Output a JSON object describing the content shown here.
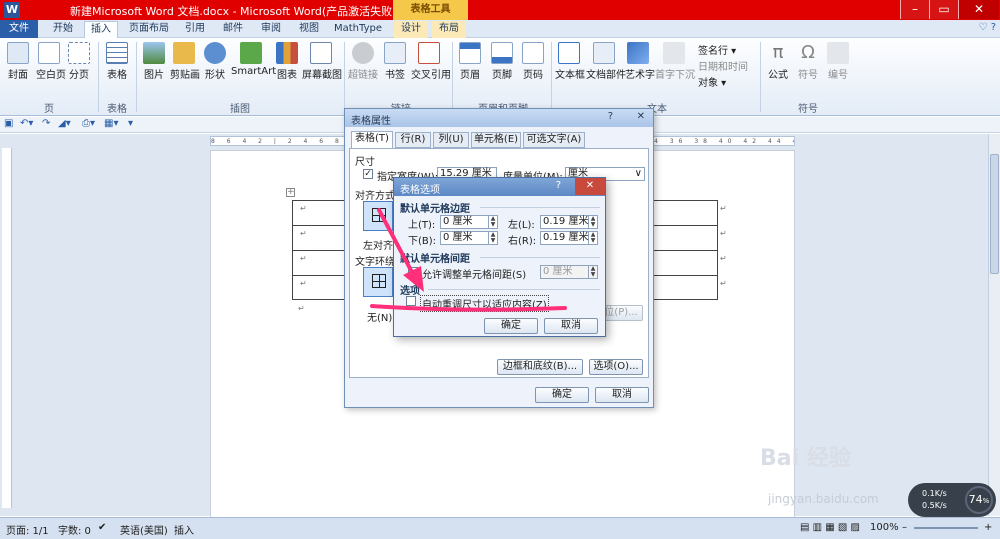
{
  "window": {
    "title": "新建Microsoft Word 文档.docx - Microsoft Word(产品激活失败)",
    "contextual_group": "表格工具",
    "quick_access_icon": "W",
    "controls": {
      "minimize": "–",
      "restore": "▭",
      "close": "✕"
    }
  },
  "ribbon_tabs": [
    "文件",
    "开始",
    "插入",
    "页面布局",
    "引用",
    "邮件",
    "审阅",
    "视图",
    "MathType",
    "设计",
    "布局"
  ],
  "ribbon_help": "♡ ?",
  "ribbon": {
    "page_group": {
      "name": "页",
      "buttons": [
        "封面",
        "空白页",
        "分页"
      ]
    },
    "table_group": {
      "name": "表格",
      "buttons": [
        "表格"
      ]
    },
    "illustrations_group": {
      "name": "插图",
      "buttons": [
        "图片",
        "剪贴画",
        "形状",
        "SmartArt",
        "图表",
        "屏幕截图"
      ]
    },
    "links_group": {
      "name": "链接",
      "buttons": [
        "超链接",
        "书签",
        "交叉引用"
      ]
    },
    "header_footer_group": {
      "name": "页眉和页脚",
      "buttons": [
        "页眉",
        "页脚",
        "页码"
      ]
    },
    "text_group": {
      "name": "文本",
      "buttons": [
        "文本框",
        "文档部件",
        "艺术字",
        "首字下沉"
      ],
      "small": [
        "签名行 ▾",
        "日期和时间",
        "对象 ▾"
      ]
    },
    "symbols_group": {
      "name": "符号",
      "buttons": [
        "公式",
        "符号",
        "编号"
      ]
    }
  },
  "status_bar": {
    "page": "页面: 1/1",
    "words": "字数: 0",
    "language": "英语(美国)",
    "mode": "插入",
    "zoom": "100%",
    "zoom_minus": "–",
    "zoom_plus": "+"
  },
  "table_properties_dialog": {
    "title": "表格属性",
    "help": "?",
    "close": "✕",
    "tabs": [
      "表格(T)",
      "行(R)",
      "列(U)",
      "单元格(E)",
      "可选文字(A)"
    ],
    "size_label": "尺寸",
    "preferred_width_label": "指定宽度(W):",
    "preferred_width_value": "15.29 厘米",
    "measure_in_label": "度量单位(M):",
    "measure_in_value": "厘米",
    "alignment_label": "对齐方式",
    "alignment_left": "左对齐",
    "wrapping_label": "文字环绕",
    "wrapping_none": "无(N)",
    "positioning_button": "定位(P)...",
    "borders_button": "边框和底纹(B)...",
    "options_button": "选项(O)...",
    "ok": "确定",
    "cancel": "取消"
  },
  "table_options_dialog": {
    "title": "表格选项",
    "help": "?",
    "close": "✕",
    "default_margins_heading": "默认单元格边距",
    "top_label": "上(T):",
    "top_value": "0 厘米",
    "left_label": "左(L):",
    "left_value": "0.19 厘米",
    "bottom_label": "下(B):",
    "bottom_value": "0 厘米",
    "right_label": "右(R):",
    "right_value": "0.19 厘米",
    "spacing_heading": "默认单元格间距",
    "allow_spacing_label": "允许调整单元格间距(S)",
    "spacing_value": "0 厘米",
    "options_heading": "选项",
    "autoresize_label": "自动重调尺寸以适应内容(Z)",
    "autoresize_checked": false,
    "ok": "确定",
    "cancel": "取消"
  },
  "netmon": {
    "speed_up": "0.1K/s",
    "speed_down": "0.5K/s",
    "percent": "74"
  },
  "watermark": {
    "brand": "Bai 经验",
    "url": "jingyan.baidu.com"
  },
  "colors": {
    "titlebar": "#e00000",
    "accent": "#2a5ea8",
    "annotation": "#ff2f7a"
  }
}
